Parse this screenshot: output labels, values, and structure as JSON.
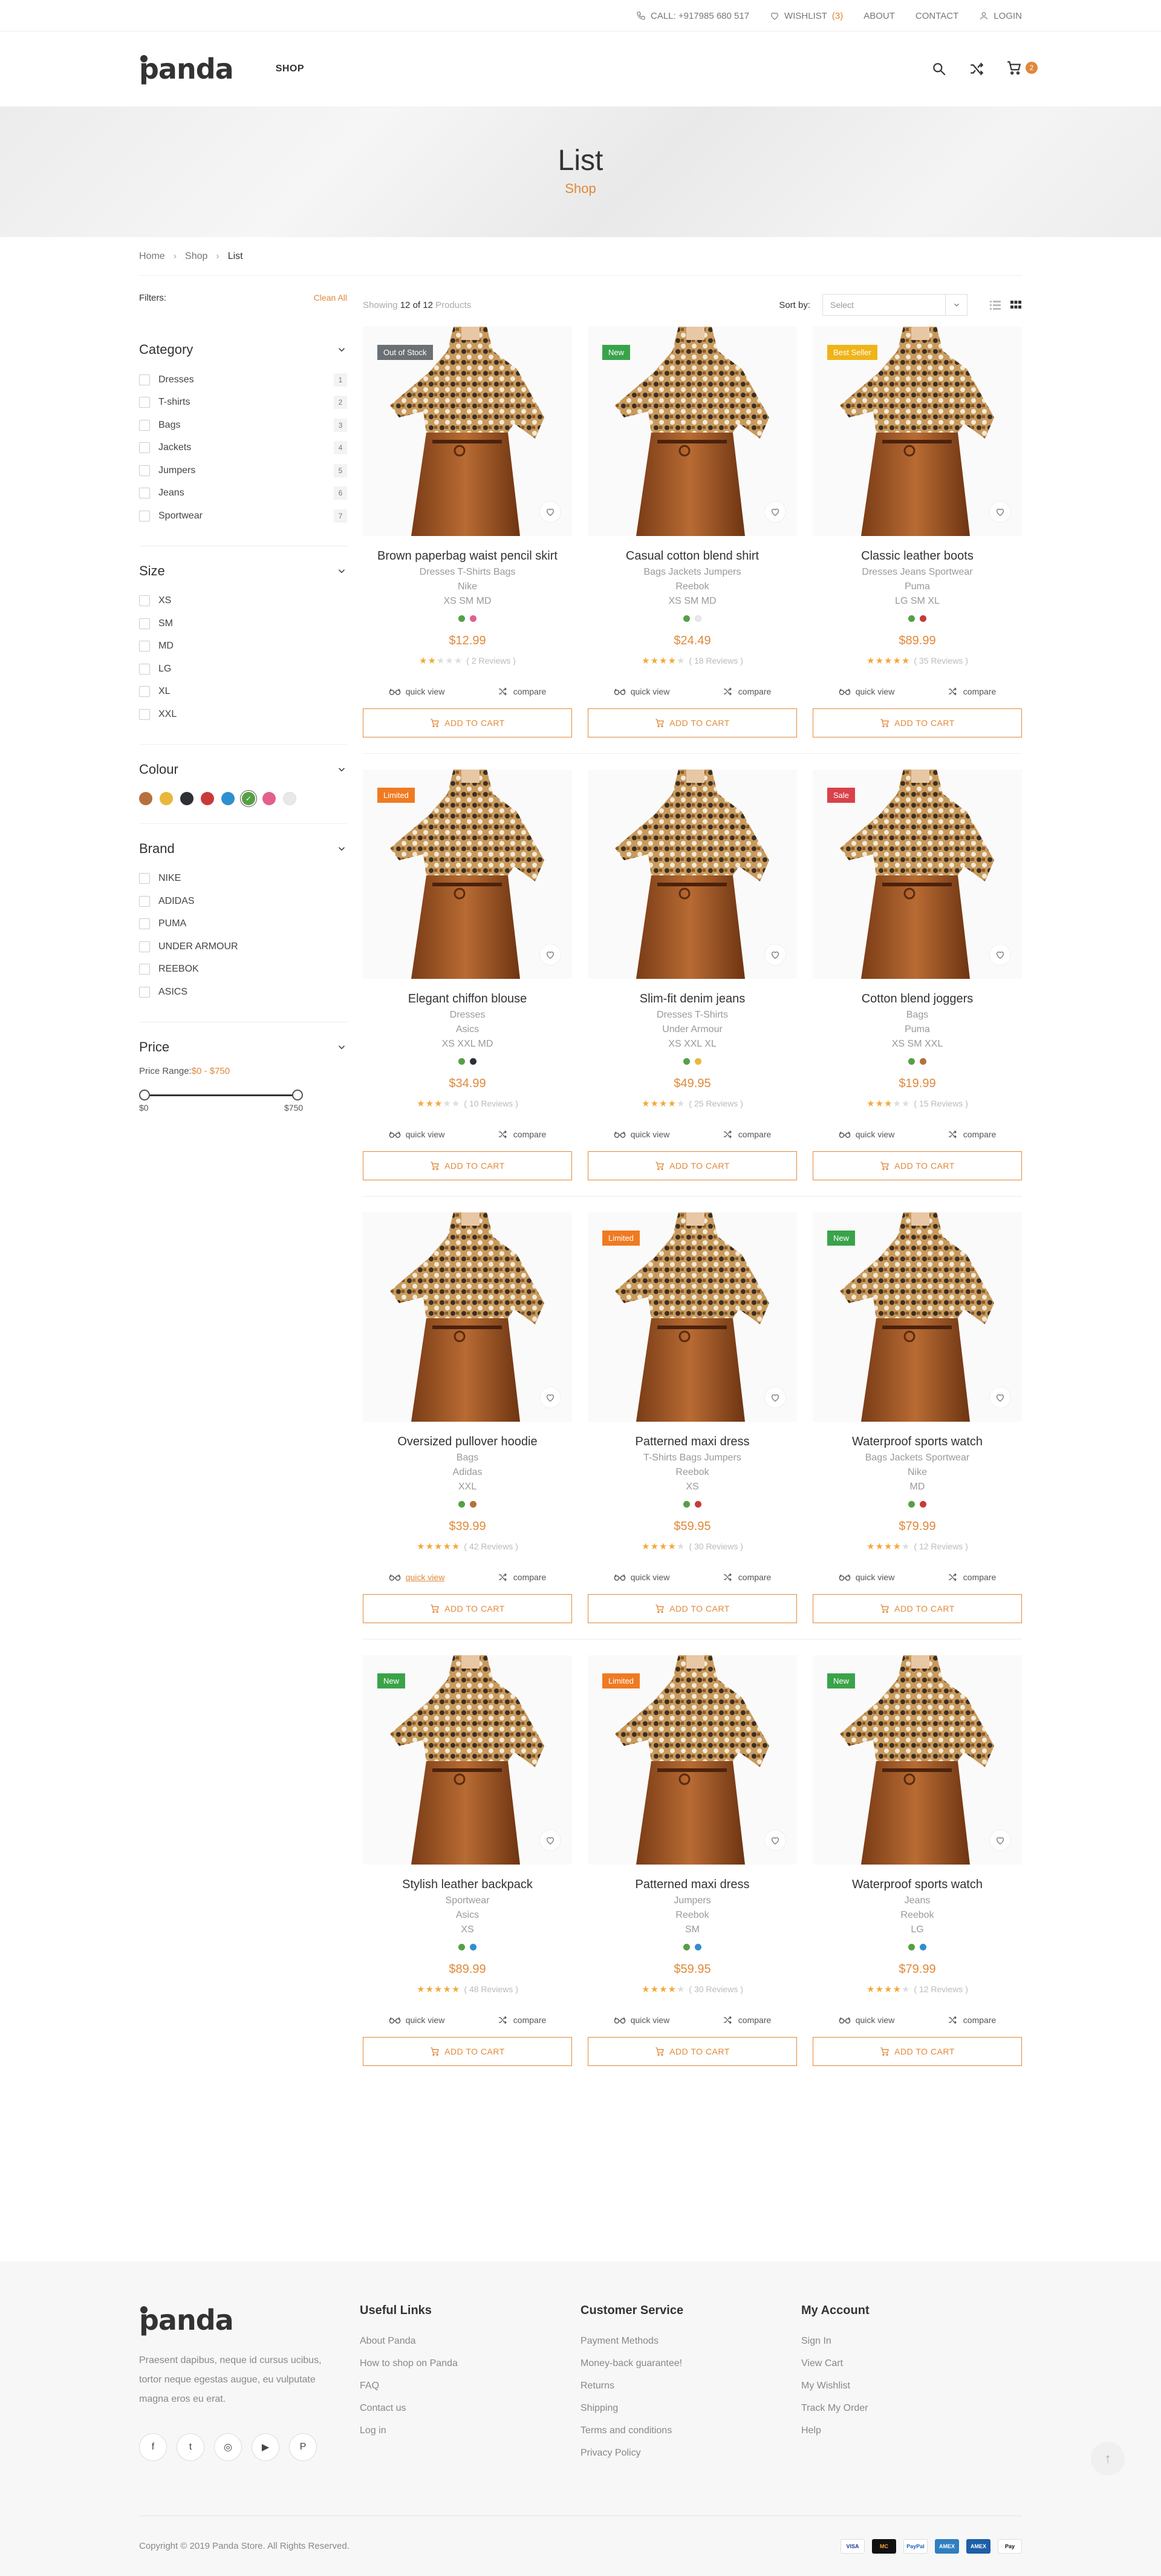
{
  "topbar": {
    "phone": "CALL: +917985 680 517",
    "wishlist_label": "WISHLIST",
    "wishlist_count": "(3)",
    "about": "ABOUT",
    "contact": "CONTACT",
    "login": "LOGIN"
  },
  "header": {
    "logo": "panda",
    "nav_shop": "SHOP",
    "cart_count": "2"
  },
  "hero": {
    "title": "List",
    "subtitle": "Shop"
  },
  "breadcrumb": [
    "Home",
    "Shop",
    "List"
  ],
  "sidebar": {
    "filters_label": "Filters:",
    "clear_all": "Clean All",
    "category": {
      "title": "Category",
      "items": [
        {
          "label": "Dresses",
          "count": "1"
        },
        {
          "label": "T-shirts",
          "count": "2"
        },
        {
          "label": "Bags",
          "count": "3"
        },
        {
          "label": "Jackets",
          "count": "4"
        },
        {
          "label": "Jumpers",
          "count": "5"
        },
        {
          "label": "Jeans",
          "count": "6"
        },
        {
          "label": "Sportwear",
          "count": "7"
        }
      ]
    },
    "size": {
      "title": "Size",
      "items": [
        "XS",
        "SM",
        "MD",
        "LG",
        "XL",
        "XXL"
      ]
    },
    "colour": {
      "title": "Colour",
      "swatches": [
        "#b5713d",
        "#e8b83c",
        "#2d3035",
        "#c83a3a",
        "#2f8fcf",
        "#55a045",
        "#e2608c",
        "#e8e8ea"
      ],
      "selected_index": 5
    },
    "brand": {
      "title": "Brand",
      "items": [
        "NIKE",
        "ADIDAS",
        "PUMA",
        "UNDER ARMOUR",
        "REEBOK",
        "ASICS"
      ]
    },
    "price": {
      "title": "Price",
      "range_label": "Price Range:",
      "range_value": "$0 - $750",
      "min": "$0",
      "max": "$750"
    }
  },
  "toolbar": {
    "showing_prefix": "Showing",
    "showing_count": "12 of 12",
    "showing_suffix": "Products",
    "sort_label": "Sort by:",
    "sort_placeholder": "Select"
  },
  "labels": {
    "quick_view": "quick view",
    "compare": "compare",
    "add_to_cart": "ADD TO CART"
  },
  "products": [
    {
      "title": "Brown paperbag waist pencil skirt",
      "badge": "Out of Stock",
      "badge_color": "#6b7075",
      "lines": [
        "Dresses T-Shirts Bags",
        "Nike",
        "XS SM MD"
      ],
      "colors": [
        "#55a045",
        "#e2608c"
      ],
      "price": "$12.99",
      "rating": 2,
      "reviews": "( 2 Reviews )"
    },
    {
      "title": "Casual cotton blend shirt",
      "badge": "New",
      "badge_color": "#3aa34a",
      "lines": [
        "Bags Jackets Jumpers",
        "Reebok",
        "XS SM MD"
      ],
      "colors": [
        "#55a045",
        "#e8e8ea"
      ],
      "price": "$24.49",
      "rating": 4,
      "reviews": "( 18 Reviews )"
    },
    {
      "title": "Classic leather boots",
      "badge": "Best Seller",
      "badge_color": "#f0b41a",
      "lines": [
        "Dresses Jeans Sportwear",
        "Puma",
        "LG SM XL"
      ],
      "colors": [
        "#55a045",
        "#c83a3a"
      ],
      "price": "$89.99",
      "rating": 5,
      "reviews": "( 35 Reviews )"
    },
    {
      "title": "Elegant chiffon blouse",
      "badge": "Limited",
      "badge_color": "#f07a22",
      "lines": [
        "Dresses",
        "Asics",
        "XS XXL MD"
      ],
      "colors": [
        "#55a045",
        "#2d3035"
      ],
      "price": "$34.99",
      "rating": 3,
      "reviews": "( 10 Reviews )"
    },
    {
      "title": "Slim-fit denim jeans",
      "badge": "",
      "badge_color": "",
      "lines": [
        "Dresses T-Shirts",
        "Under Armour",
        "XS XXL XL"
      ],
      "colors": [
        "#55a045",
        "#e8b83c"
      ],
      "price": "$49.95",
      "rating": 4,
      "reviews": "( 25 Reviews )"
    },
    {
      "title": "Cotton blend joggers",
      "badge": "Sale",
      "badge_color": "#d9424a",
      "lines": [
        "Bags",
        "Puma",
        "XS SM XXL"
      ],
      "colors": [
        "#55a045",
        "#b5713d"
      ],
      "price": "$19.99",
      "rating": 3,
      "reviews": "( 15 Reviews )"
    },
    {
      "title": "Oversized pullover hoodie",
      "badge": "",
      "badge_color": "",
      "lines": [
        "Bags",
        "Adidas",
        "XXL"
      ],
      "colors": [
        "#55a045",
        "#b5713d"
      ],
      "price": "$39.99",
      "rating": 5,
      "reviews": "( 42 Reviews )"
    },
    {
      "title": "Patterned maxi dress",
      "badge": "Limited",
      "badge_color": "#f07a22",
      "lines": [
        "T-Shirts Bags Jumpers",
        "Reebok",
        "XS"
      ],
      "colors": [
        "#55a045",
        "#c83a3a"
      ],
      "price": "$59.95",
      "rating": 4,
      "reviews": "( 30 Reviews )"
    },
    {
      "title": "Waterproof sports watch",
      "badge": "New",
      "badge_color": "#3aa34a",
      "lines": [
        "Bags Jackets Sportwear",
        "Nike",
        "MD"
      ],
      "colors": [
        "#55a045",
        "#c83a3a"
      ],
      "price": "$79.99",
      "rating": 4,
      "reviews": "( 12 Reviews )"
    },
    {
      "title": "Stylish leather backpack",
      "badge": "New",
      "badge_color": "#3aa34a",
      "lines": [
        "Sportwear",
        "Asics",
        "XS"
      ],
      "colors": [
        "#55a045",
        "#2f8fcf"
      ],
      "price": "$89.99",
      "rating": 5,
      "reviews": "( 48 Reviews )"
    },
    {
      "title": "Patterned maxi dress",
      "badge": "Limited",
      "badge_color": "#f07a22",
      "lines": [
        "Jumpers",
        "Reebok",
        "SM"
      ],
      "colors": [
        "#55a045",
        "#2f8fcf"
      ],
      "price": "$59.95",
      "rating": 4,
      "reviews": "( 30 Reviews )"
    },
    {
      "title": "Waterproof sports watch",
      "badge": "New",
      "badge_color": "#3aa34a",
      "lines": [
        "Jeans",
        "Reebok",
        "LG"
      ],
      "colors": [
        "#55a045",
        "#2f8fcf"
      ],
      "price": "$79.99",
      "rating": 4,
      "reviews": "( 12 Reviews )"
    }
  ],
  "footer": {
    "logo": "panda",
    "about": "Praesent dapibus, neque id cursus ucibus, tortor neque egestas augue, eu vulputate magna eros eu erat.",
    "useful_links": {
      "title": "Useful Links",
      "items": [
        "About Panda",
        "How to shop on Panda",
        "FAQ",
        "Contact us",
        "Log in"
      ]
    },
    "customer_service": {
      "title": "Customer Service",
      "items": [
        "Payment Methods",
        "Money-back guarantee!",
        "Returns",
        "Shipping",
        "Terms and conditions",
        "Privacy Policy"
      ]
    },
    "my_account": {
      "title": "My Account",
      "items": [
        "Sign In",
        "View Cart",
        "My Wishlist",
        "Track My Order",
        "Help"
      ]
    },
    "copyright": "Copyright © 2019 Panda Store. All Rights Reserved.",
    "payments": [
      {
        "label": "VISA",
        "color": "#ffffff",
        "text": "#1a3b8e"
      },
      {
        "label": "MC",
        "color": "#111111",
        "text": "#f2a33a"
      },
      {
        "label": "PayPal",
        "color": "#ffffff",
        "text": "#1e63b6"
      },
      {
        "label": "AMEX",
        "color": "#2f7fc1",
        "text": "#ffffff"
      },
      {
        "label": "AMEX",
        "color": "#1d5fa8",
        "text": "#ffffff"
      },
      {
        "label": "Pay",
        "color": "#ffffff",
        "text": "#111111"
      }
    ]
  }
}
